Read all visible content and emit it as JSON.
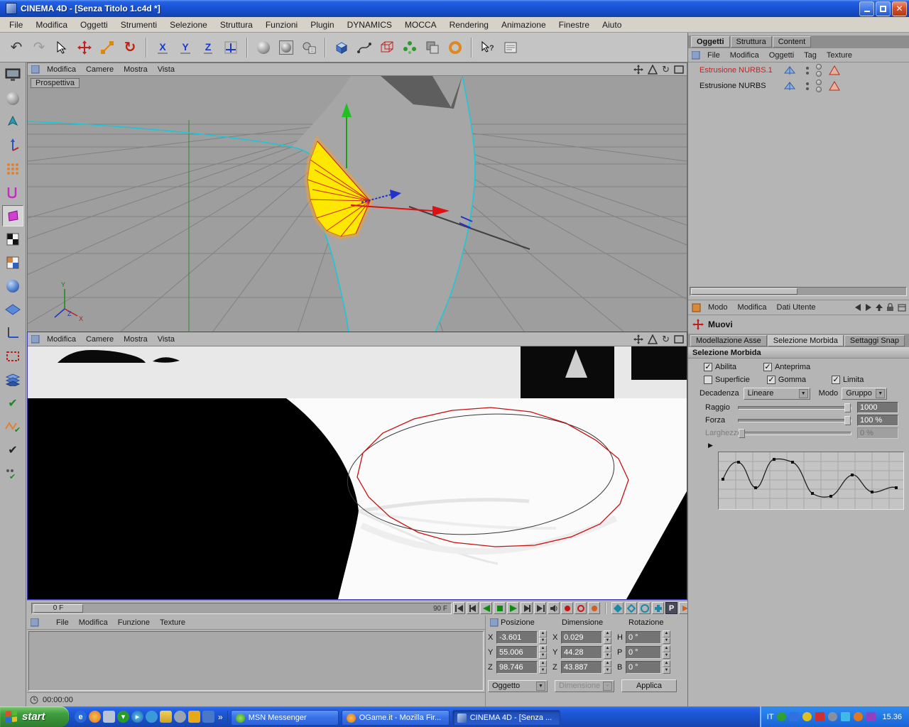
{
  "window": {
    "title": "CINEMA 4D - [Senza Titolo 1.c4d *]"
  },
  "menubar": {
    "items": [
      "File",
      "Modifica",
      "Oggetti",
      "Strumenti",
      "Selezione",
      "Struttura",
      "Funzioni",
      "Plugin",
      "DYNAMICS",
      "MOCCA",
      "Rendering",
      "Animazione",
      "Finestre",
      "Aiuto"
    ]
  },
  "toolbar": {
    "axis_x": "X",
    "axis_y": "Y",
    "axis_z": "Z"
  },
  "viewport": {
    "menu": [
      "Modifica",
      "Camere",
      "Mostra",
      "Vista"
    ],
    "perspective_label": "Prospettiva",
    "axis_y": "Y",
    "axis_z": "Z",
    "axis_x": "X"
  },
  "timeline": {
    "current_frame": "0 F",
    "end_frame": "90 F",
    "p_button": "P"
  },
  "materials": {
    "menu": [
      "File",
      "Modifica",
      "Funzione",
      "Texture"
    ],
    "timecode": "00:00:00"
  },
  "coords": {
    "headers": [
      "Posizione",
      "Dimensione",
      "Rotazione"
    ],
    "pos_labels": [
      "X",
      "Y",
      "Z"
    ],
    "rot_labels": [
      "H",
      "P",
      "B"
    ],
    "pos": [
      "-3.601",
      "55.006",
      "98.746"
    ],
    "dim": [
      "0.029",
      "44.28",
      "43.887"
    ],
    "rot": [
      "0 °",
      "0 °",
      "0 °"
    ],
    "mode": "Oggetto",
    "dim_mode": "Dimensione",
    "apply": "Applica"
  },
  "objects": {
    "tabs": [
      "Oggetti",
      "Struttura",
      "Content"
    ],
    "menu": [
      "File",
      "Modifica",
      "Oggetti",
      "Tag",
      "Texture"
    ],
    "items": [
      "Estrusione NURBS.1",
      "Estrusione NURBS"
    ]
  },
  "attributes": {
    "menu": [
      "Modo",
      "Modifica",
      "Dati Utente"
    ],
    "tool": "Muovi",
    "tabs": [
      "Modellazione Asse",
      "Selezione Morbida",
      "Settaggi Snap"
    ],
    "section": "Selezione Morbida",
    "checks": [
      "Abilita",
      "Anteprima",
      "Superficie",
      "Gomma",
      "Limita"
    ],
    "decadenza_label": "Decadenza",
    "decadenza": "Lineare",
    "modo_label": "Modo",
    "modo": "Gruppo",
    "raggio_label": "Raggio",
    "raggio": "1000",
    "forza_label": "Forza",
    "forza": "100 %",
    "larghezza_label": "Larghezza",
    "larghezza": "0 %"
  },
  "taskbar": {
    "start": "start",
    "tasks": [
      "MSN Messenger",
      "OGame.it - Mozilla Fir...",
      "CINEMA 4D - [Senza ..."
    ],
    "lang": "IT",
    "clock": "15.36"
  },
  "colors": {
    "titlebar_blue": "#1952d6",
    "taskbar_blue": "#245edb",
    "selected_object_red": "#c42222",
    "selection_yellow": "#ffe800",
    "spline_cyan": "#18c8d8"
  }
}
